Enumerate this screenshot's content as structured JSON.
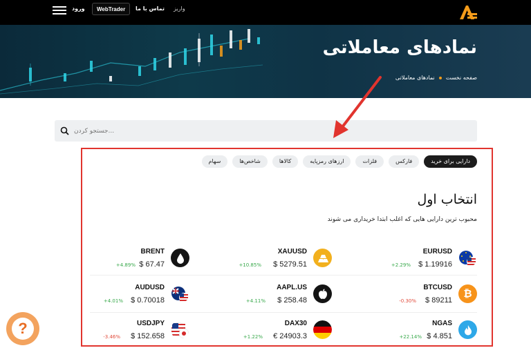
{
  "nav": {
    "login": "ورود",
    "webtrader": "WebTrader",
    "contact": "تماس با ما",
    "deposit": "واریز"
  },
  "hero": {
    "title": "نمادهای معاملاتی",
    "breadcrumb_home": "صفحه نخست",
    "breadcrumb_current": "نمادهای معاملاتی"
  },
  "search": {
    "placeholder": "...جستجو کردن"
  },
  "tabs": [
    {
      "label": "دارایی برای خرید",
      "active": true
    },
    {
      "label": "فارکس"
    },
    {
      "label": "فلزات"
    },
    {
      "label": "ارزهای رمزپایه"
    },
    {
      "label": "کالاها"
    },
    {
      "label": "شاخص‌ها"
    },
    {
      "label": "سهام"
    }
  ],
  "section": {
    "title": "انتخاب اول",
    "subtitle": "محبوب ترین دارایی هایی که اغلب ابتدا خریداری می شوند"
  },
  "assets": [
    {
      "symbol": "EURUSD",
      "price": "$ 1.19916",
      "change": "+2.29%",
      "direction": "up",
      "icon": "eu-us-flag-icon"
    },
    {
      "symbol": "XAUUSD",
      "price": "$ 5279.51",
      "change": "+10.85%",
      "direction": "up",
      "icon": "gold-bars-icon"
    },
    {
      "symbol": "BRENT",
      "price": "$ 67.47",
      "change": "+4.89%",
      "direction": "up",
      "icon": "oil-drop-icon"
    },
    {
      "symbol": "BTCUSD",
      "price": "$ 89211",
      "change": "-0.30%",
      "direction": "down",
      "icon": "bitcoin-icon"
    },
    {
      "symbol": "AAPL.US",
      "price": "$ 258.48",
      "change": "+4.11%",
      "direction": "up",
      "icon": "apple-icon"
    },
    {
      "symbol": "AUDUSD",
      "price": "$ 0.70018",
      "change": "+4.01%",
      "direction": "up",
      "icon": "au-us-flag-icon"
    },
    {
      "symbol": "NGAS",
      "price": "$ 4.851",
      "change": "+22.14%",
      "direction": "up",
      "icon": "gas-flame-icon"
    },
    {
      "symbol": "DAX30",
      "price": "€ 24903.3",
      "change": "+1.22%",
      "direction": "up",
      "icon": "germany-flag-icon"
    },
    {
      "symbol": "USDJPY",
      "price": "$ 152.658",
      "change": "-3.46%",
      "direction": "down",
      "icon": "us-jp-flag-icon"
    }
  ],
  "colors": {
    "accent_orange": "#f59c1a",
    "highlight_red": "#e1342e",
    "positive": "#37a84a",
    "negative": "#e14b3b"
  },
  "help": {
    "label": "?"
  }
}
